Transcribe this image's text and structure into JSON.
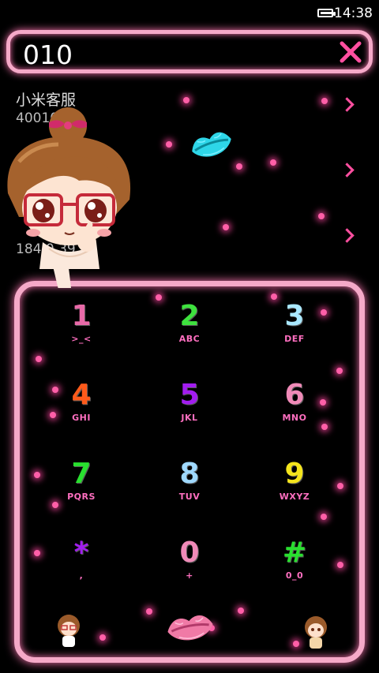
{
  "status_bar": {
    "time": "14:38"
  },
  "search": {
    "value": "010"
  },
  "contacts": [
    {
      "name": "小米客服",
      "number": "40010 58"
    },
    {
      "name": "",
      "number": ""
    },
    {
      "name": "",
      "number": "184 0 39"
    }
  ],
  "keypad": {
    "keys": [
      {
        "digit": "1",
        "letters": ">_<",
        "color": "#e86aa8"
      },
      {
        "digit": "2",
        "letters": "ABC",
        "color": "#3ee23e"
      },
      {
        "digit": "3",
        "letters": "DEF",
        "color": "#a9e8ff"
      },
      {
        "digit": "4",
        "letters": "GHI",
        "color": "#ff5a1a"
      },
      {
        "digit": "5",
        "letters": "JKL",
        "color": "#a21cf0"
      },
      {
        "digit": "6",
        "letters": "MNO",
        "color": "#f08ab8"
      },
      {
        "digit": "7",
        "letters": "PQRS",
        "color": "#29e02f"
      },
      {
        "digit": "8",
        "letters": "TUV",
        "color": "#9fd9ff"
      },
      {
        "digit": "9",
        "letters": "WXYZ",
        "color": "#f4e51c"
      },
      {
        "digit": "*",
        "letters": ",",
        "color": "#a21cf0"
      },
      {
        "digit": "0",
        "letters": "+",
        "color": "#f08ab8"
      },
      {
        "digit": "#",
        "letters": "0_0",
        "color": "#29e02f"
      }
    ]
  },
  "colors": {
    "accent_pink": "#f5a9c8",
    "chevron_pink": "#ff4fa0",
    "lips_cyan": "#2ed6e8",
    "lips_pink": "#f07aa6"
  },
  "icons": [
    "battery-icon",
    "clear-icon",
    "chevron-right-icon",
    "cyan-lips-icon",
    "pink-lips-icon",
    "girl-avatar-icon",
    "girl-character-icon"
  ]
}
